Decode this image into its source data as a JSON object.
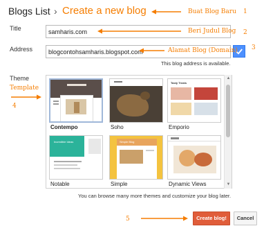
{
  "header": {
    "breadcrumb_root": "Blogs List",
    "separator": "›",
    "page_title": "Create a new blog"
  },
  "form": {
    "title_label": "Title",
    "title_value": "samharis.com",
    "address_label": "Address",
    "address_value": "blogcontohsamharis.blogspot.com",
    "address_status": "This blog address is available.",
    "theme_label": "Theme"
  },
  "themes": [
    {
      "name": "Contempo",
      "selected": true
    },
    {
      "name": "Soho",
      "selected": false
    },
    {
      "name": "Emporio",
      "selected": false
    },
    {
      "name": "Notable",
      "selected": false
    },
    {
      "name": "Simple",
      "selected": false
    },
    {
      "name": "Dynamic Views",
      "selected": false
    }
  ],
  "theme_previews": {
    "emporio_title": "Tasty Treats",
    "notable_title": "Incredible Ideas",
    "simple_title": "Simple Blog"
  },
  "footer_hint": "You can browse many more themes and customize your blog later.",
  "actions": {
    "create_label": "Create blog!",
    "cancel_label": "Cancel"
  },
  "annotations": {
    "a1_text": "Buat Blog Baru",
    "a1_num": "1",
    "a2_text": "Beri Judul Blog",
    "a2_num": "2",
    "a3_text": "Alamat Blog (Domain)",
    "a3_num": "3",
    "a4_text": "Template",
    "a4_num": "4",
    "a5_num": "5"
  },
  "colors": {
    "accent_orange": "#f57d00",
    "create_button": "#e05d3a",
    "check_button": "#4d90fe"
  }
}
